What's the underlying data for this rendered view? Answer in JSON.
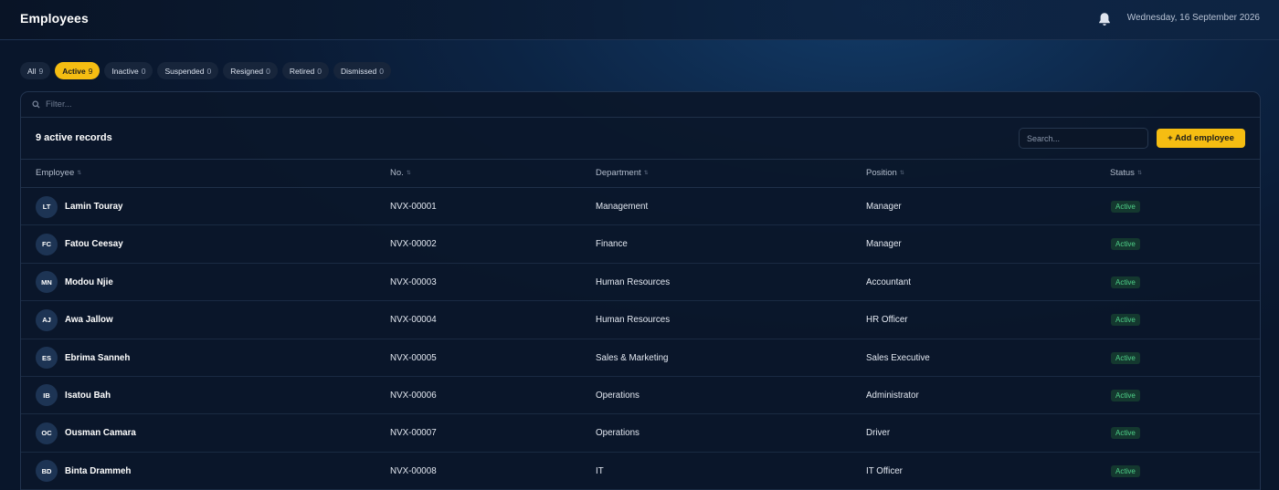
{
  "header": {
    "title": "Employees",
    "date": "Wednesday, 16 September 2026",
    "bell_icon": "bell-icon"
  },
  "filters": [
    {
      "label": "All",
      "count": "9",
      "active": false
    },
    {
      "label": "Active",
      "count": "9",
      "active": true
    },
    {
      "label": "Inactive",
      "count": "0",
      "active": false
    },
    {
      "label": "Suspended",
      "count": "0",
      "active": false
    },
    {
      "label": "Resigned",
      "count": "0",
      "active": false
    },
    {
      "label": "Retired",
      "count": "0",
      "active": false
    },
    {
      "label": "Dismissed",
      "count": "0",
      "active": false
    }
  ],
  "filter_bar": {
    "placeholder": "Filter...",
    "icon": "search-icon"
  },
  "records": {
    "title": "9 active records",
    "search_placeholder": "Search...",
    "add_label": "+ Add employee"
  },
  "columns": [
    "Employee",
    "No.",
    "Department",
    "Position",
    "Status"
  ],
  "rows": [
    {
      "initials": "LT",
      "name": "Lamin Touray",
      "no": "NVX-00001",
      "department": "Management",
      "position": "Manager",
      "status": "Active"
    },
    {
      "initials": "FC",
      "name": "Fatou Ceesay",
      "no": "NVX-00002",
      "department": "Finance",
      "position": "Manager",
      "status": "Active"
    },
    {
      "initials": "MN",
      "name": "Modou Njie",
      "no": "NVX-00003",
      "department": "Human Resources",
      "position": "Accountant",
      "status": "Active"
    },
    {
      "initials": "AJ",
      "name": "Awa Jallow",
      "no": "NVX-00004",
      "department": "Human Resources",
      "position": "HR Officer",
      "status": "Active"
    },
    {
      "initials": "ES",
      "name": "Ebrima Sanneh",
      "no": "NVX-00005",
      "department": "Sales & Marketing",
      "position": "Sales Executive",
      "status": "Active"
    },
    {
      "initials": "IB",
      "name": "Isatou Bah",
      "no": "NVX-00006",
      "department": "Operations",
      "position": "Administrator",
      "status": "Active"
    },
    {
      "initials": "OC",
      "name": "Ousman Camara",
      "no": "NVX-00007",
      "department": "Operations",
      "position": "Driver",
      "status": "Active"
    },
    {
      "initials": "BD",
      "name": "Binta Drammeh",
      "no": "NVX-00008",
      "department": "IT",
      "position": "IT Officer",
      "status": "Active"
    }
  ],
  "colors": {
    "accent": "#f5bd12",
    "status_active": "#4fd28a"
  }
}
